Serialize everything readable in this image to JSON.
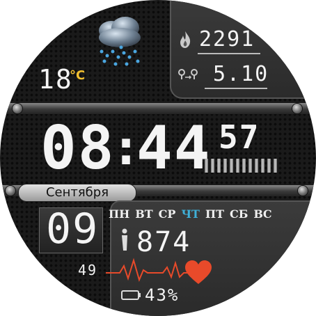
{
  "weather": {
    "icon": "cloud-rain-icon",
    "temperature": "18",
    "unit": "°C",
    "unit_color": "#f2c030"
  },
  "stats": {
    "calories_icon": "flame-icon",
    "calories": "2291",
    "distance_icon": "distance-icon",
    "distance": "5.10"
  },
  "time": {
    "hours": "08",
    "minutes": "44",
    "seconds": "57",
    "separator": ":"
  },
  "date": {
    "month": "Сентября",
    "day": "09",
    "weekdays": [
      "ПН",
      "ВТ",
      "СР",
      "ЧТ",
      "ПТ",
      "СБ",
      "ВС"
    ],
    "active_weekday_index": 3,
    "active_color": "#3fb0d8"
  },
  "steps": {
    "icon": "steps-icon",
    "value": "874"
  },
  "heart": {
    "value": "49",
    "icon": "heart-icon",
    "color": "#e84a2a"
  },
  "battery": {
    "icon": "battery-icon",
    "value": "43%"
  }
}
